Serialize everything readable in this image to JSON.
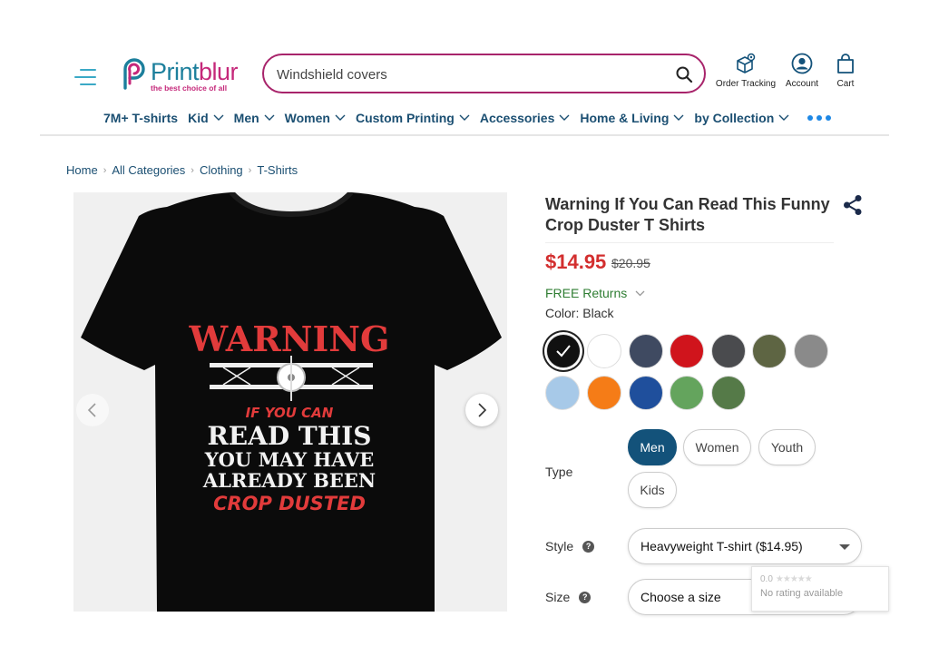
{
  "header": {
    "logo_main": "Print",
    "logo_accent": "blur",
    "logo_tagline": "the best choice of all",
    "search_value": "Windshield covers",
    "actions": [
      {
        "label": "Order Tracking",
        "icon": "package-location-icon"
      },
      {
        "label": "Account",
        "icon": "user-icon"
      },
      {
        "label": "Cart",
        "icon": "shopping-bag-icon"
      }
    ]
  },
  "nav": [
    {
      "label": "7M+ T-shirts",
      "dropdown": false
    },
    {
      "label": "Kid",
      "dropdown": true
    },
    {
      "label": "Men",
      "dropdown": true
    },
    {
      "label": "Women",
      "dropdown": true
    },
    {
      "label": "Custom Printing",
      "dropdown": true
    },
    {
      "label": "Accessories",
      "dropdown": true
    },
    {
      "label": "Home & Living",
      "dropdown": true
    },
    {
      "label": "by Collection",
      "dropdown": true
    }
  ],
  "breadcrumb": [
    "Home",
    "All Categories",
    "Clothing",
    "T-Shirts"
  ],
  "product": {
    "title": "Warning If You Can Read This Funny Crop Duster T Shirts",
    "price": "$14.95",
    "old_price": "$20.95",
    "free_returns": "FREE Returns",
    "color_label": "Color:",
    "color_value": "Black",
    "print_text": {
      "line1": "WARNING",
      "line2": "IF YOU CAN",
      "line3": "READ THIS",
      "line4": "YOU MAY HAVE",
      "line5": "ALREADY BEEN",
      "line6": "CROP DUSTED"
    },
    "colors": [
      {
        "name": "Black",
        "hex": "#111111",
        "selected": true
      },
      {
        "name": "White",
        "hex": "#ffffff",
        "selected": false
      },
      {
        "name": "Navy Slate",
        "hex": "#3f4a61",
        "selected": false
      },
      {
        "name": "Red",
        "hex": "#d0141c",
        "selected": false
      },
      {
        "name": "Charcoal",
        "hex": "#4a4b4e",
        "selected": false
      },
      {
        "name": "Olive",
        "hex": "#5e6543",
        "selected": false
      },
      {
        "name": "Grey",
        "hex": "#8a8a8a",
        "selected": false
      },
      {
        "name": "Light Blue",
        "hex": "#a7c9e8",
        "selected": false
      },
      {
        "name": "Orange",
        "hex": "#f57c17",
        "selected": false
      },
      {
        "name": "Royal Blue",
        "hex": "#1f4f9c",
        "selected": false
      },
      {
        "name": "Green",
        "hex": "#64a45d",
        "selected": false
      },
      {
        "name": "Moss",
        "hex": "#557a48",
        "selected": false
      }
    ],
    "type_label": "Type",
    "types": [
      {
        "label": "Men",
        "active": true
      },
      {
        "label": "Women",
        "active": false
      },
      {
        "label": "Youth",
        "active": false
      },
      {
        "label": "Kids",
        "active": false
      }
    ],
    "style_label": "Style",
    "style_value": "Heavyweight T-shirt ($14.95)",
    "size_label": "Size",
    "size_value": "Choose a size"
  },
  "rating": {
    "score": "0.0",
    "stars": "★★★★★",
    "text": "No rating available"
  }
}
